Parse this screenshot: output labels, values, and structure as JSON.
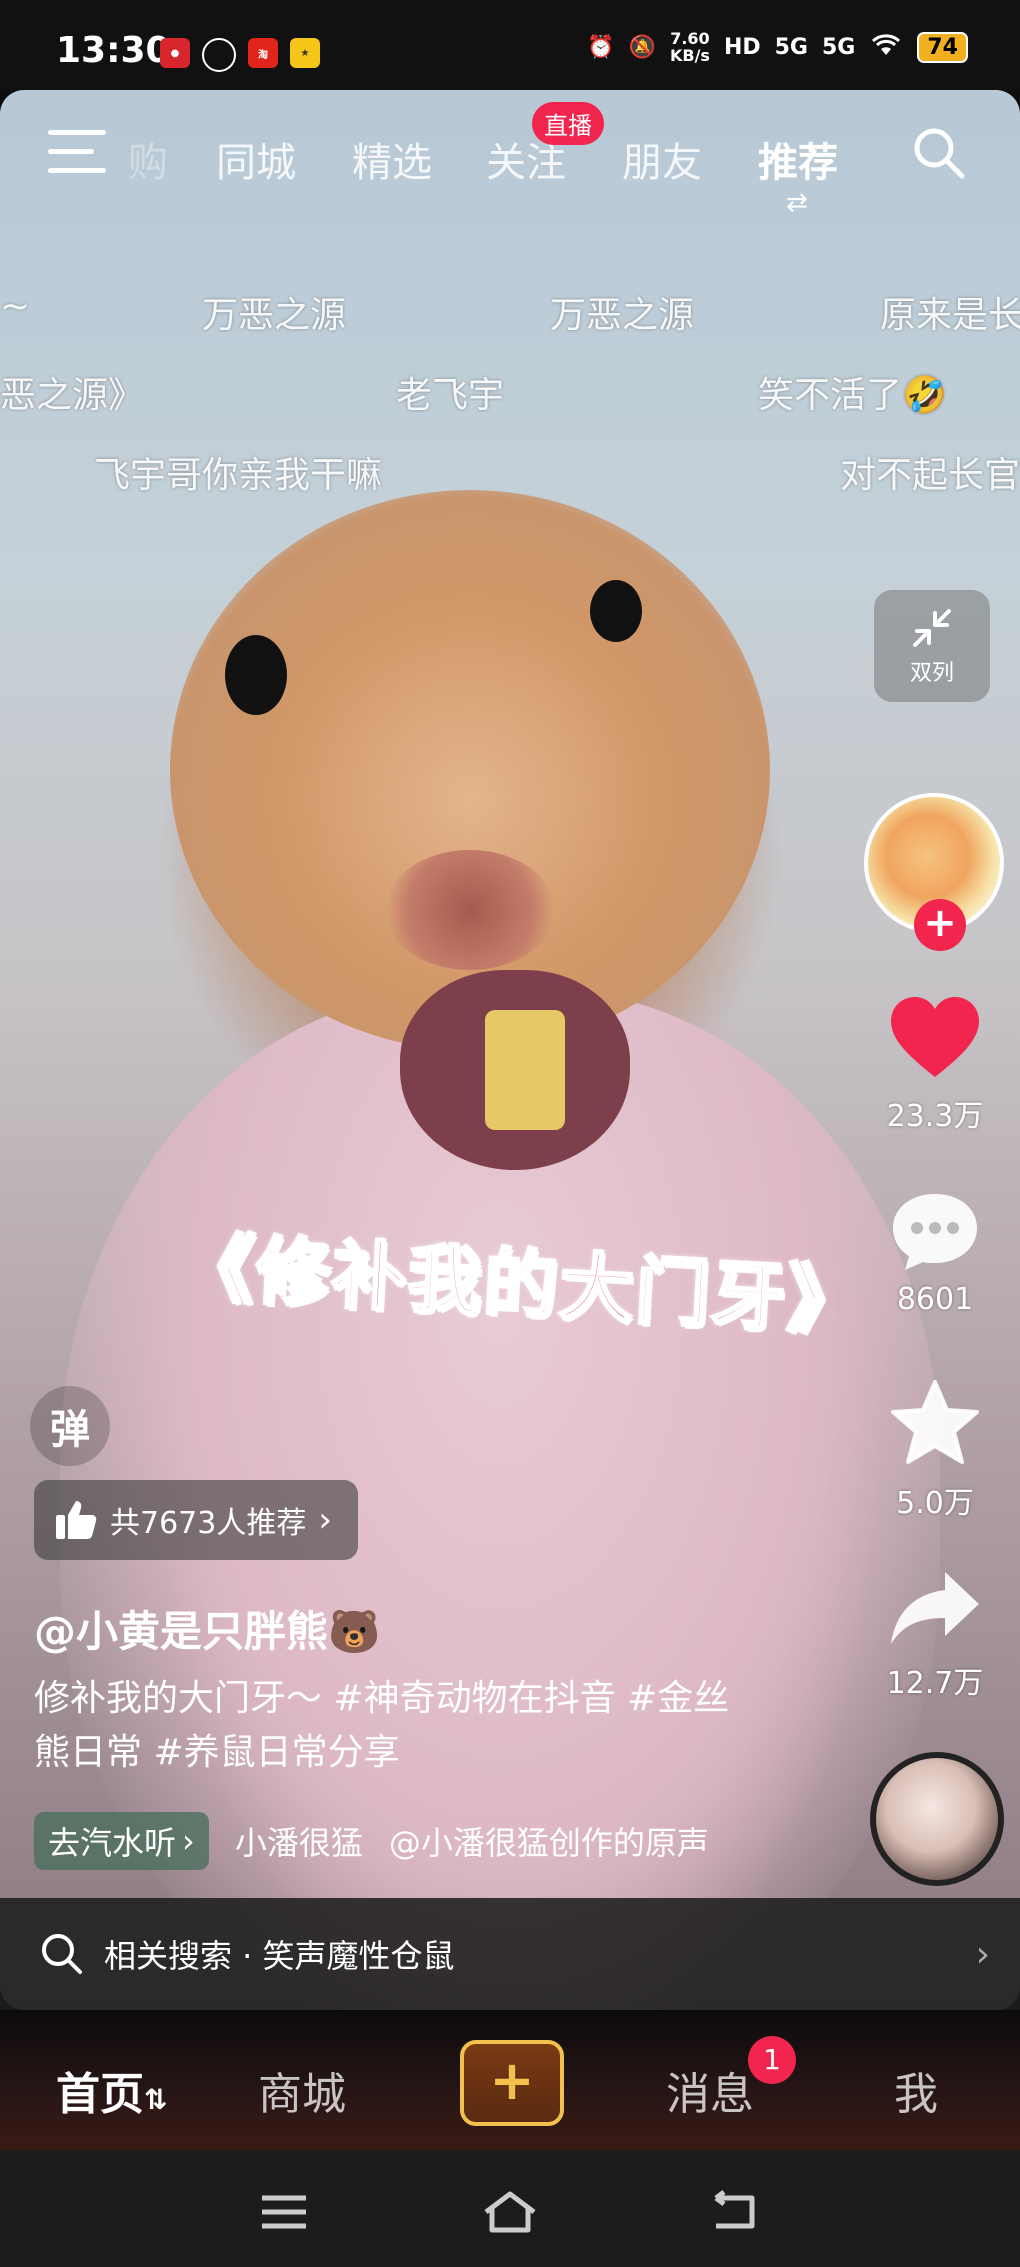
{
  "status_bar": {
    "time": "13:30",
    "net_speed_value": "7.60",
    "net_speed_unit": "KB/s",
    "hd_label": "HD",
    "signal1": "5G",
    "signal2": "5G",
    "battery": "74"
  },
  "top_nav": {
    "cut_tab": "购",
    "tabs": [
      "同城",
      "精选",
      "关注",
      "朋友",
      "推荐"
    ],
    "active_tab": "推荐",
    "live_badge": "直播"
  },
  "danmaku": [
    "~",
    "万恶之源",
    "万恶之源",
    "原来是长",
    "恶之源》",
    "老飞宇",
    "笑不活了🤣",
    "飞宇哥你亲我干嘛",
    "对不起长官"
  ],
  "video": {
    "caption_overlay": "《修补我的大门牙》"
  },
  "rail": {
    "dual_label": "双列",
    "like_count": "23.3万",
    "comment_count": "8601",
    "favorite_count": "5.0万",
    "share_count": "12.7万"
  },
  "info": {
    "danmu_toggle": "弹",
    "recommend_text": "共7673人推荐",
    "author": "@小黄是只胖熊🐻",
    "description": "修补我的大门牙～ #神奇动物在抖音 #金丝熊日常 #养鼠日常分享",
    "qishui_label": "去汽水听",
    "music_artist": "小潘很猛",
    "music_title": "@小潘很猛创作的原声"
  },
  "related_search": {
    "text": "相关搜索 · 笑声魔性仓鼠"
  },
  "tabbar": {
    "home": "首页",
    "mall": "商城",
    "plus": "+",
    "messages": "消息",
    "message_badge": "1",
    "me": "我"
  },
  "colors": {
    "accent_red": "#f2254e",
    "plus_gold": "#f2c04e",
    "battery_yellow": "#f2b01e"
  }
}
